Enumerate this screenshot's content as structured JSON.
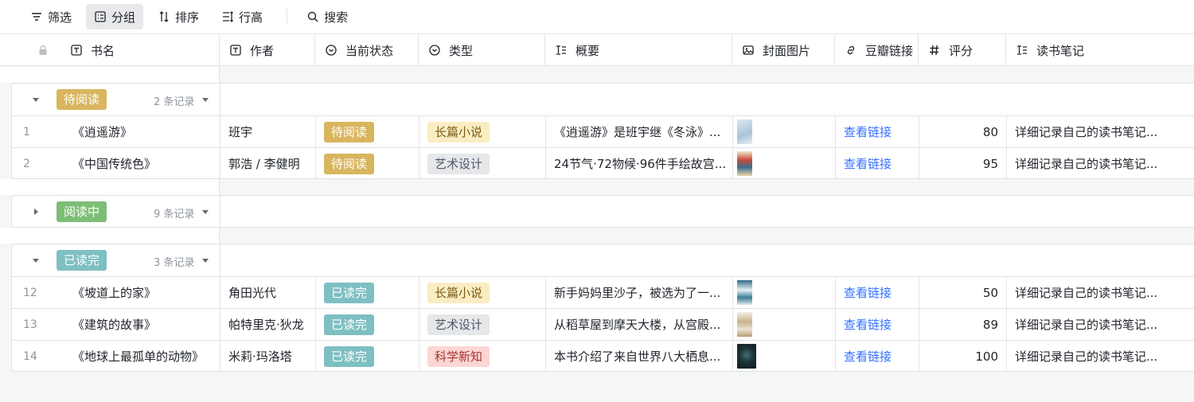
{
  "toolbar": {
    "filter": "筛选",
    "group": "分组",
    "sort": "排序",
    "row_height": "行高",
    "search": "搜索"
  },
  "columns": {
    "title": "书名",
    "author": "作者",
    "status": "当前状态",
    "type": "类型",
    "summary": "概要",
    "cover": "封面图片",
    "link": "豆瓣链接",
    "score": "评分",
    "notes": "读书笔记"
  },
  "colors": {
    "to_read": "#d9b55f",
    "reading": "#7dbe76",
    "done": "#7ebfc2",
    "type_novel_bg": "#faedc2",
    "type_art_bg": "#e6e7e9",
    "type_science_bg": "#fbd6d4",
    "link": "#3370ff"
  },
  "groups": [
    {
      "label": "待阅读",
      "count": "2 条记录",
      "expanded": true,
      "color": "#d9b55f",
      "rows": [
        {
          "num": "1",
          "title": "《逍遥游》",
          "author": "班宇",
          "status": "待阅读",
          "type": "长篇小说",
          "summary": "《逍遥游》是班宇继《冬泳》...",
          "link": "查看链接",
          "score": "80",
          "notes": "详细记录自己的读书笔记..."
        },
        {
          "num": "2",
          "title": "《中国传统色》",
          "author": "郭浩 / 李健明",
          "status": "待阅读",
          "type": "艺术设计",
          "summary": "24节气·72物候·96件手绘故宫...",
          "link": "查看链接",
          "score": "95",
          "notes": "详细记录自己的读书笔记..."
        }
      ]
    },
    {
      "label": "阅读中",
      "count": "9 条记录",
      "expanded": false,
      "color": "#7dbe76",
      "rows": []
    },
    {
      "label": "已读完",
      "count": "3 条记录",
      "expanded": true,
      "color": "#7ebfc2",
      "rows": [
        {
          "num": "12",
          "title": "《坡道上的家》",
          "author": "角田光代",
          "status": "已读完",
          "type": "长篇小说",
          "summary": "新手妈妈里沙子，被选为了一...",
          "link": "查看链接",
          "score": "50",
          "notes": "详细记录自己的读书笔记..."
        },
        {
          "num": "13",
          "title": "《建筑的故事》",
          "author": "帕特里克·狄龙",
          "status": "已读完",
          "type": "艺术设计",
          "summary": "从稻草屋到摩天大楼，从宫殿...",
          "link": "查看链接",
          "score": "89",
          "notes": "详细记录自己的读书笔记..."
        },
        {
          "num": "14",
          "title": "《地球上最孤单的动物》",
          "author": "米莉·玛洛塔",
          "status": "已读完",
          "type": "科学新知",
          "summary": "本书介绍了来自世界八大栖息...",
          "link": "查看链接",
          "score": "100",
          "notes": "详细记录自己的读书笔记..."
        }
      ]
    }
  ]
}
